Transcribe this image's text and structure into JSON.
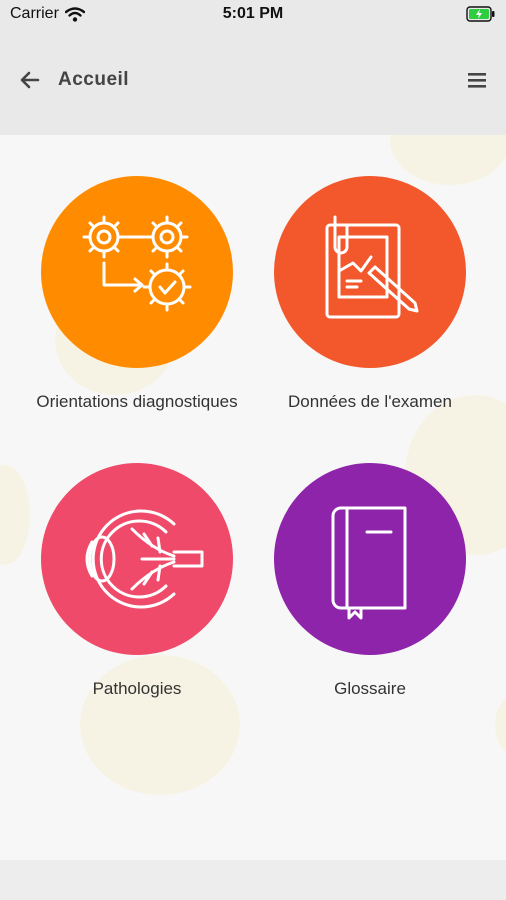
{
  "status_bar": {
    "carrier": "Carrier",
    "time": "5:01 PM"
  },
  "nav": {
    "title": "Accueil",
    "back_icon": "arrow-left-icon",
    "menu_icon": "hamburger-menu-icon"
  },
  "tiles": [
    {
      "label": "Orientations diagnostiques",
      "color": "#ff8c00",
      "icon": "gears-flow-icon"
    },
    {
      "label": "Données de l'examen",
      "color": "#f2582b",
      "icon": "clipboard-pencil-icon"
    },
    {
      "label": "Pathologies",
      "color": "#f04a6a",
      "icon": "eye-anatomy-icon"
    },
    {
      "label": "Glossaire",
      "color": "#8e24aa",
      "icon": "book-icon"
    }
  ]
}
